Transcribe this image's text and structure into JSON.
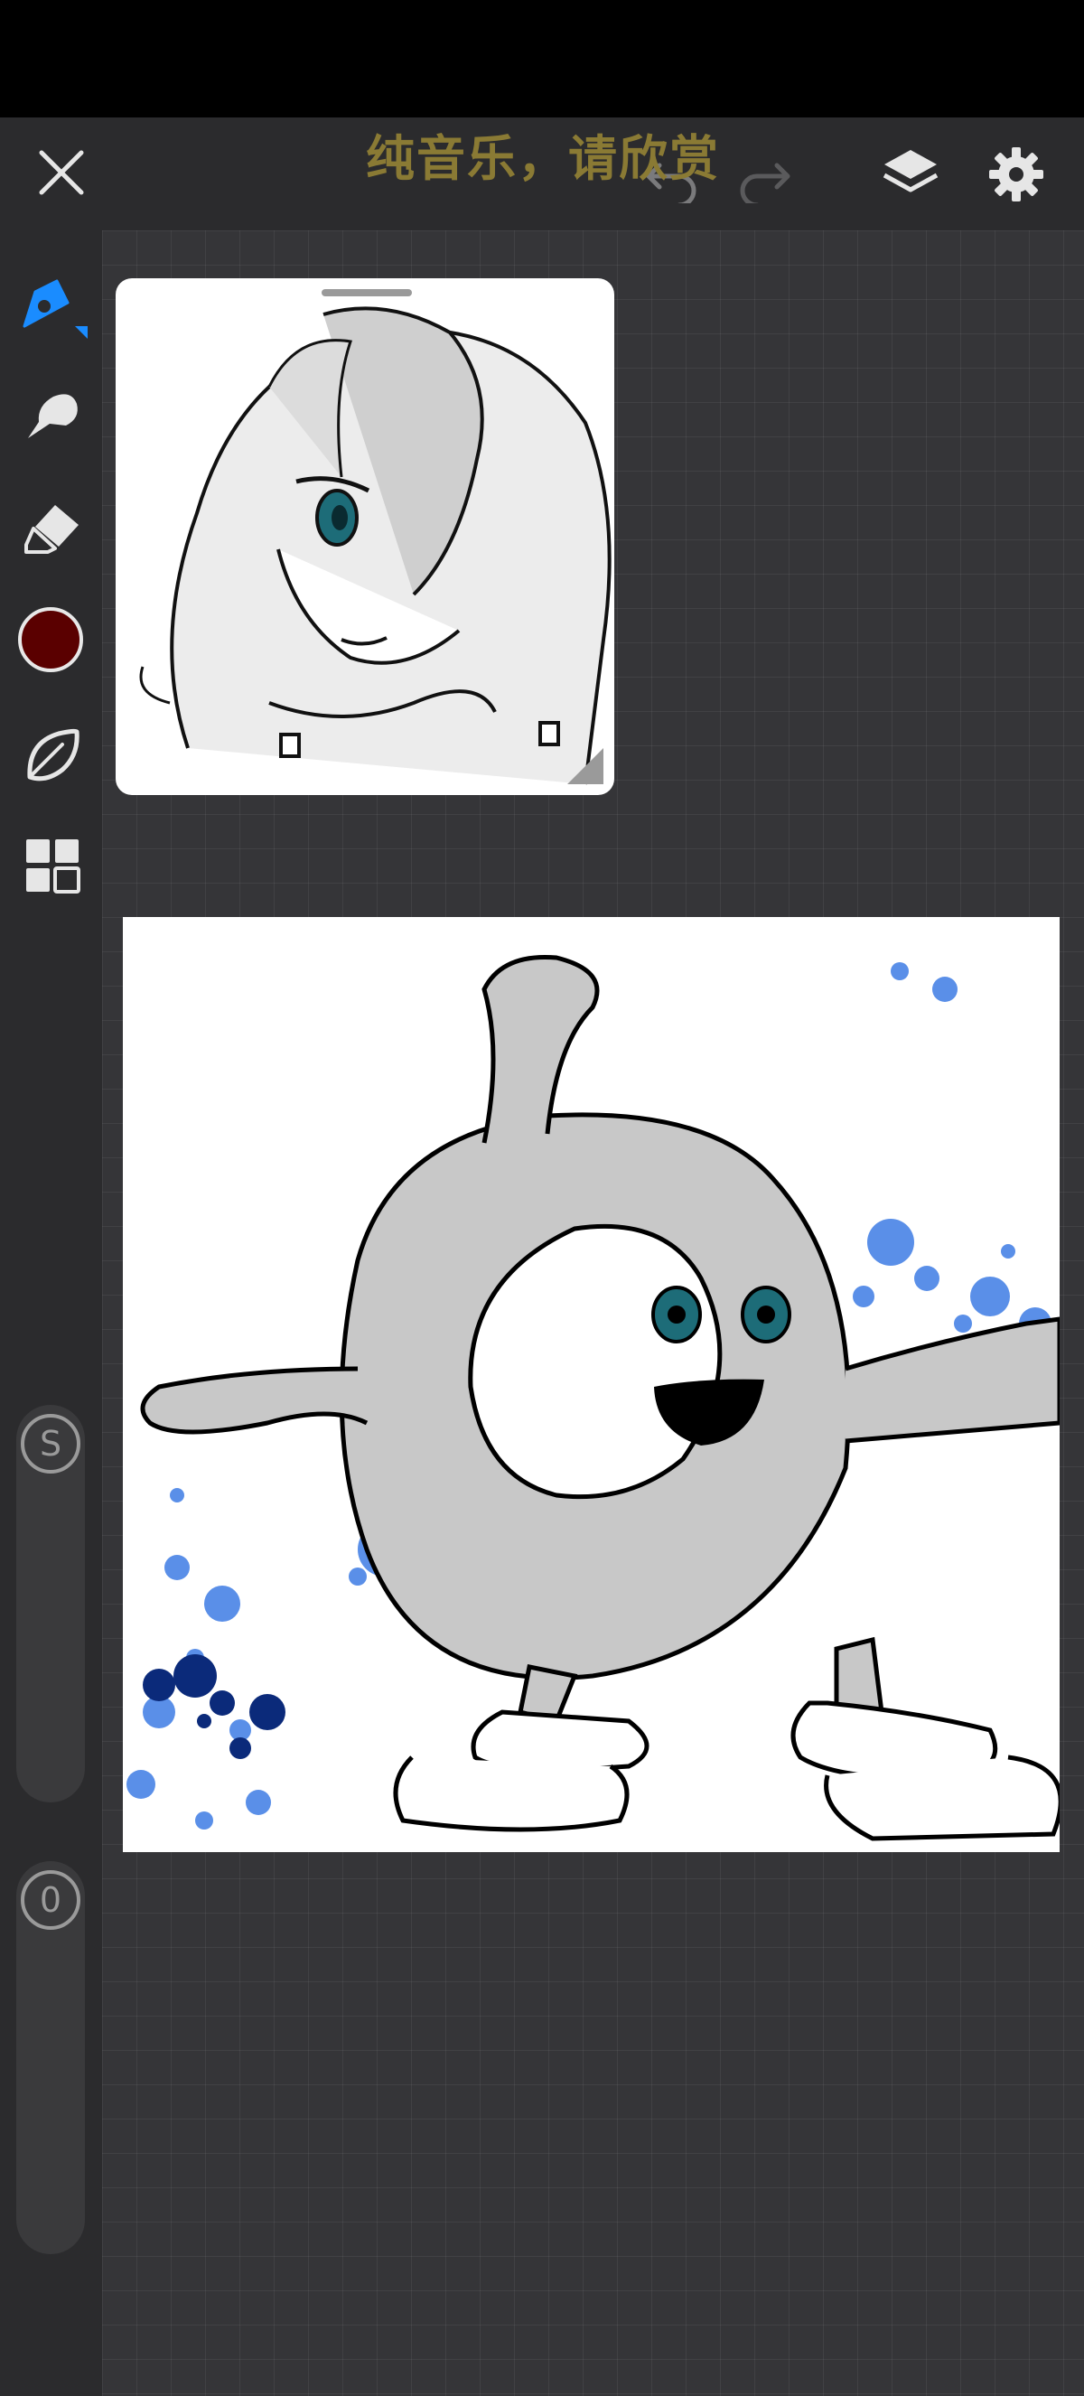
{
  "overlay_caption": "纯音乐，请欣赏",
  "toolbar": {
    "close_icon": "close-icon",
    "undo_icon": "undo-icon",
    "redo_icon": "redo-icon",
    "layers_icon": "layers-icon",
    "settings_icon": "gear-icon"
  },
  "tools": [
    {
      "name": "pencil",
      "icon": "pencil-icon",
      "active": true
    },
    {
      "name": "smudge",
      "icon": "smudge-icon"
    },
    {
      "name": "eraser",
      "icon": "eraser-icon"
    },
    {
      "name": "color",
      "icon": "color-swatch",
      "color": "#5a0000"
    },
    {
      "name": "shapes",
      "icon": "leaf-icon"
    },
    {
      "name": "more",
      "icon": "grid-icon"
    }
  ],
  "sliders": {
    "size_label": "S",
    "opacity_label": "0"
  },
  "colors": {
    "accent": "#1a8cff",
    "current_brush": "#5a0000",
    "caption": "#8a7a34"
  }
}
